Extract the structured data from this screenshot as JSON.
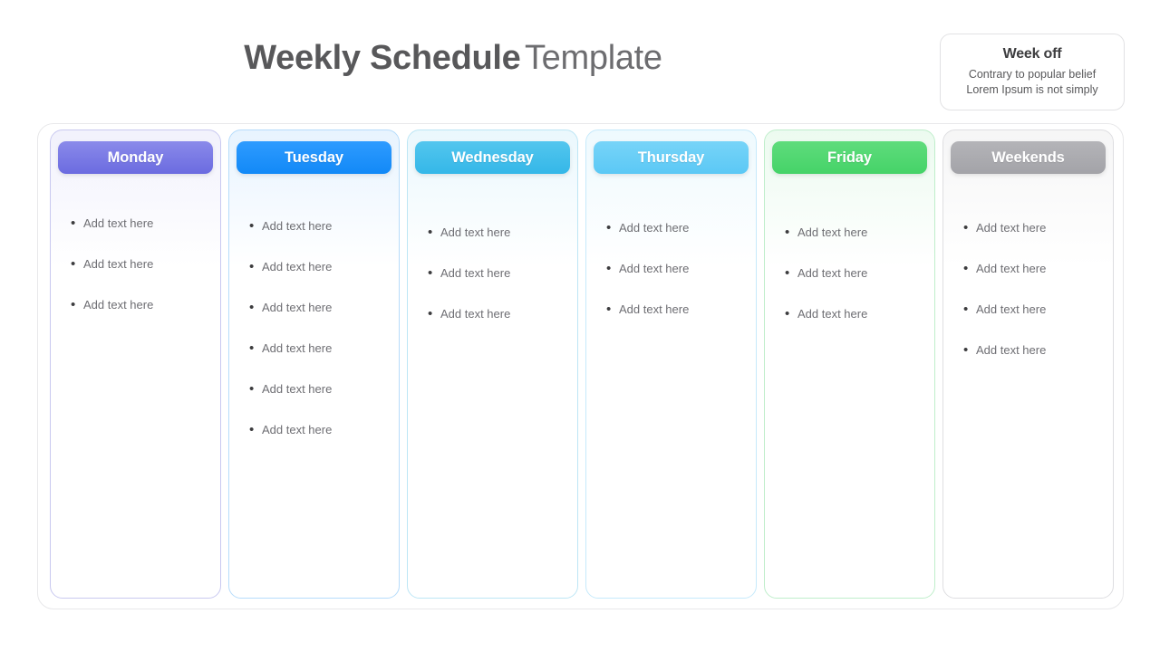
{
  "header": {
    "title_bold": "Weekly Schedule",
    "title_light": "Template"
  },
  "week_off": {
    "title": "Week off",
    "line1": "Contrary to popular belief",
    "line2": "Lorem Ipsum is not simply"
  },
  "columns": [
    {
      "day": "Monday",
      "color": "#6B6BE0",
      "color_light": "#8A8AEA",
      "tint": "rgba(123,123,228,0.10)",
      "border": "#c9c9f0",
      "tasks": [
        "Add text here",
        "Add text here",
        "Add text here"
      ]
    },
    {
      "day": "Tuesday",
      "color": "#1289F7",
      "color_light": "#2E9BFF",
      "tint": "rgba(26,140,250,0.10)",
      "border": "#b6dcfb",
      "tasks": [
        "Add text here",
        "Add text here",
        "Add text here",
        "Add text here",
        "Add text here",
        "Add text here"
      ]
    },
    {
      "day": "Wednesday",
      "color": "#34B7E8",
      "color_light": "#53C6EE",
      "tint": "rgba(52,183,232,0.10)",
      "border": "#bde6f5",
      "tasks": [
        "Add text here",
        "Add text here",
        "Add text here"
      ]
    },
    {
      "day": "Thursday",
      "color": "#5BC8F5",
      "color_light": "#77D4F8",
      "tint": "rgba(91,200,245,0.10)",
      "border": "#c6eafb",
      "tasks": [
        "Add text here",
        "Add text here",
        "Add text here"
      ]
    },
    {
      "day": "Friday",
      "color": "#45D368",
      "color_light": "#5FDC7C",
      "tint": "rgba(69,211,104,0.10)",
      "border": "#bfeecb",
      "tasks": [
        "Add text here",
        "Add text here",
        "Add text here"
      ]
    },
    {
      "day": "Weekends",
      "color": "#A3A3A8",
      "color_light": "#B4B4B8",
      "tint": "rgba(163,163,168,0.10)",
      "border": "#dedee1",
      "tasks": [
        "Add text here",
        "Add text here",
        "Add text here",
        "Add text here"
      ]
    }
  ],
  "bullet_glyph": "•"
}
